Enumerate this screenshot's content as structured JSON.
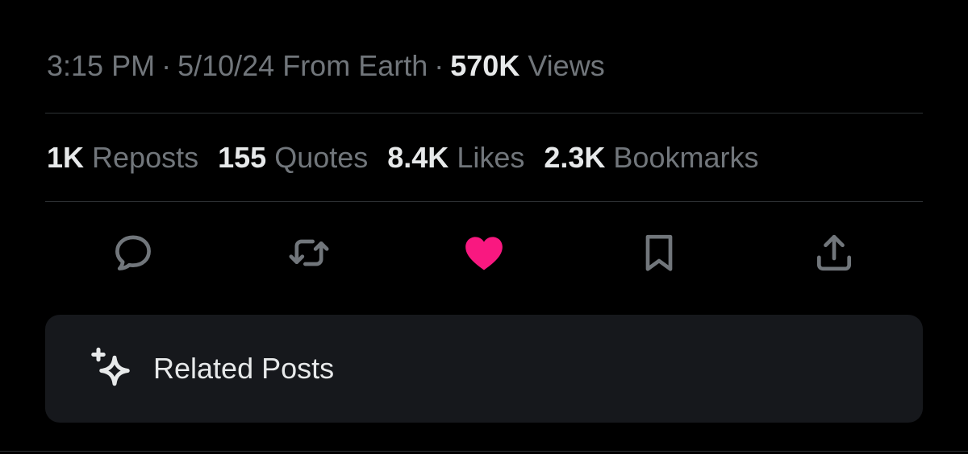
{
  "meta": {
    "time": "3:15 PM",
    "separator": "·",
    "date": "5/10/24",
    "source": "From Earth",
    "views_count": "570K",
    "views_label": "Views"
  },
  "stats": [
    {
      "count": "1K",
      "label": "Reposts"
    },
    {
      "count": "155",
      "label": "Quotes"
    },
    {
      "count": "8.4K",
      "label": "Likes"
    },
    {
      "count": "2.3K",
      "label": "Bookmarks"
    }
  ],
  "actions": [
    {
      "icon": "reply-icon",
      "active": false
    },
    {
      "icon": "repost-icon",
      "active": false
    },
    {
      "icon": "heart-icon",
      "active": true
    },
    {
      "icon": "bookmark-icon",
      "active": false
    },
    {
      "icon": "share-icon",
      "active": false
    }
  ],
  "related": {
    "icon": "sparkle-icon",
    "label": "Related Posts"
  },
  "colors": {
    "background": "#000000",
    "muted_text": "#71767b",
    "primary_text": "#e7e9ea",
    "divider": "#2f3336",
    "like_active": "#f91880",
    "card_background": "#16181c"
  }
}
